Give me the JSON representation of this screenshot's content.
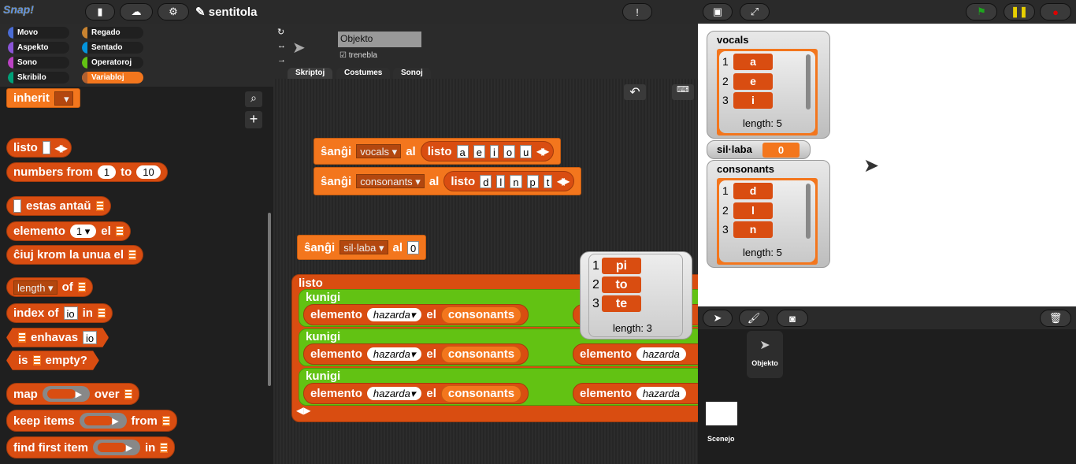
{
  "topbar": {
    "logo": "Snap!",
    "project_title": "✎ sentitola",
    "file_icon": "file-icon",
    "cloud_icon": "cloud-icon",
    "settings_icon": "gear-icon",
    "stage_buttons": [
      "!",
      "▣",
      "⤢"
    ]
  },
  "colors": {
    "lists": "#d94d11",
    "variables": "#f3761d",
    "operators": "#62c213"
  },
  "categories": [
    {
      "label": "Movo",
      "color": "#4a6cd4"
    },
    {
      "label": "Regado",
      "color": "#c88330"
    },
    {
      "label": "Aspekto",
      "color": "#8a55d7"
    },
    {
      "label": "Sentado",
      "color": "#0494dc"
    },
    {
      "label": "Sono",
      "color": "#bb42c3"
    },
    {
      "label": "Operatoroj",
      "color": "#62c213"
    },
    {
      "label": "Skribilo",
      "color": "#00a178"
    },
    {
      "label": "Variabloj",
      "color": "#f3761d",
      "selected": true
    }
  ],
  "sprite": {
    "name": "Objekto",
    "draggable_label": "trenebla",
    "draggable": true
  },
  "tabs": [
    "Skriptoj",
    "Costumes",
    "Sonoj"
  ],
  "palette": {
    "inherit": "inherit",
    "listo": "listo",
    "numbers_from": "numbers from",
    "nf_a": "1",
    "to": "to",
    "nf_b": "10",
    "estas_antau": "estas antaŭ",
    "elemento": "elemento",
    "el": "el",
    "elem_idx": "1",
    "ciuj_krom": "ĉiuj krom la unua el",
    "length": "length",
    "of": "of",
    "index_of": "index of",
    "io": "io",
    "in": "in",
    "enhavas": "enhavas",
    "is": "is",
    "empty": "empty?",
    "map": "map",
    "over": "over",
    "keep_items": "keep items",
    "from": "from",
    "find_first": "find first item"
  },
  "scripts": {
    "set": "ŝanĝi",
    "al": "al",
    "listo": "listo",
    "set1": {
      "var": "vocals",
      "items": [
        "a",
        "e",
        "i",
        "o",
        "u"
      ]
    },
    "set2": {
      "var": "consonants",
      "items": [
        "d",
        "l",
        "n",
        "p",
        "t"
      ]
    },
    "set3": {
      "var": "sil·laba",
      "value": "0"
    },
    "join": "kunigi",
    "elemento": "elemento",
    "hazarda": "hazarda",
    "el": "el",
    "consonants": "consonants",
    "bubble": {
      "items": [
        "pi",
        "to",
        "te"
      ],
      "length": "length: 3"
    }
  },
  "stage": {
    "vocals": {
      "label": "vocals",
      "items": [
        "a",
        "e",
        "i"
      ],
      "length": "length: 5"
    },
    "sillaba": {
      "label": "sil·laba",
      "value": "0"
    },
    "consonants": {
      "label": "consonants",
      "items": [
        "d",
        "l",
        "n"
      ],
      "length": "length: 5"
    }
  },
  "corral": {
    "sprite": "Objekto",
    "stage": "Scenejo"
  }
}
